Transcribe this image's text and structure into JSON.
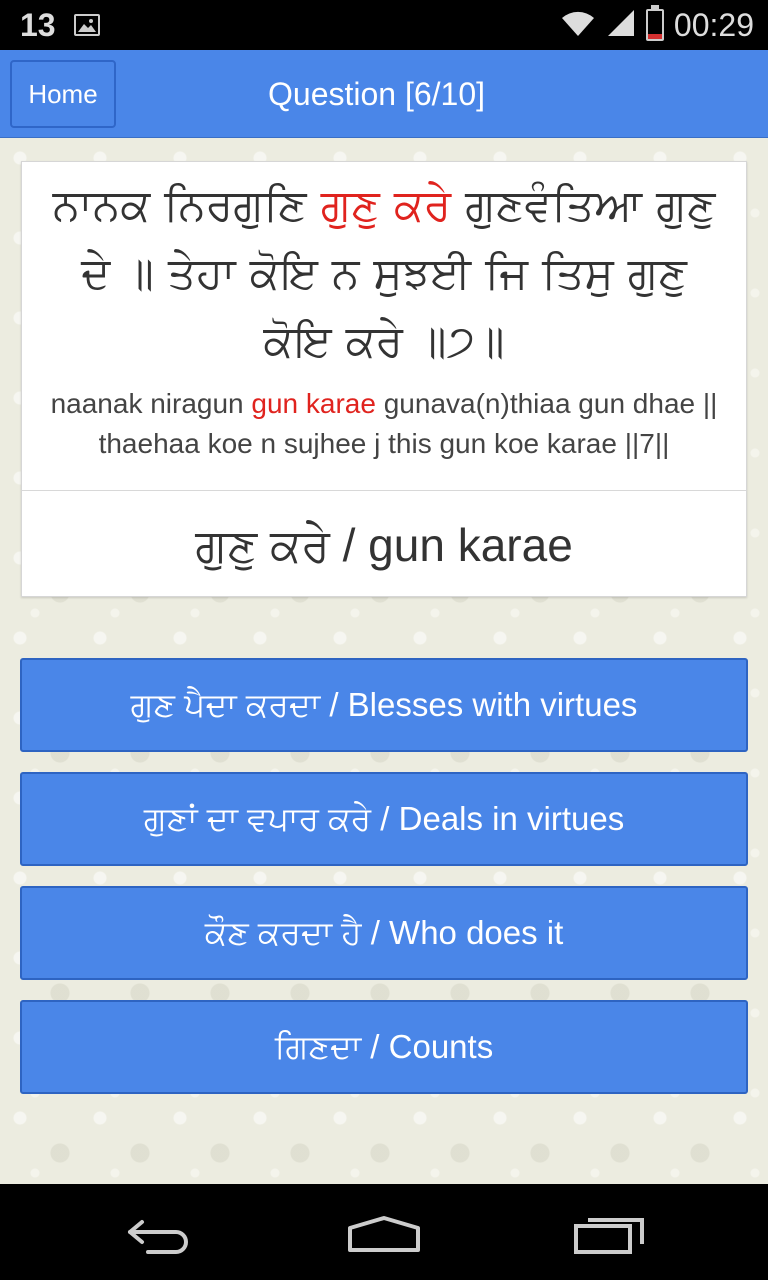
{
  "status_bar": {
    "notification_count": "13",
    "time": "00:29",
    "icons": [
      "image-icon",
      "wifi-icon",
      "signal-icon",
      "battery-low-icon"
    ]
  },
  "header": {
    "home_label": "Home",
    "title": "Question [6/10]"
  },
  "question": {
    "gurmukhi_before": "ਨਾਨਕ ਨਿਰਗੁਣਿ ",
    "gurmukhi_highlight": "ਗੁਣੁ ਕਰੇ",
    "gurmukhi_after": " ਗੁਣਵੰਤਿਆ ਗੁਣੁ ਦੇ ॥ ਤੇਹਾ ਕੋਇ ਨ ਸੁਝਈ ਜਿ ਤਿਸੁ ਗੁਣੁ ਕੋਇ ਕਰੇ ॥੭॥",
    "translit_before": "naanak niragun ",
    "translit_highlight": "gun karae",
    "translit_after": " gunava(n)thiaa gun dhae || thaehaa koe n sujhee j this gun koe karae ||7||",
    "answer_word": "ਗੁਣੁ ਕਰੇ / gun karae",
    "highlight_color": "#e0231e"
  },
  "options": [
    {
      "label": "ਗੁਣ ਪੈਦਾ ਕਰਦਾ / Blesses with virtues"
    },
    {
      "label": "ਗੁਣਾਂ ਦਾ ਵਪਾਰ ਕਰੇ / Deals in virtues"
    },
    {
      "label": "ਕੌਣ ਕਰਦਾ ਹੈ / Who does it"
    },
    {
      "label": "ਗਿਣਦਾ / Counts"
    }
  ],
  "nav_bar": {
    "icons": [
      "back-icon",
      "home-icon",
      "recent-apps-icon"
    ]
  },
  "colors": {
    "accent": "#4a86e8",
    "accent_border": "#2e64c2",
    "background": "#ecece0"
  }
}
